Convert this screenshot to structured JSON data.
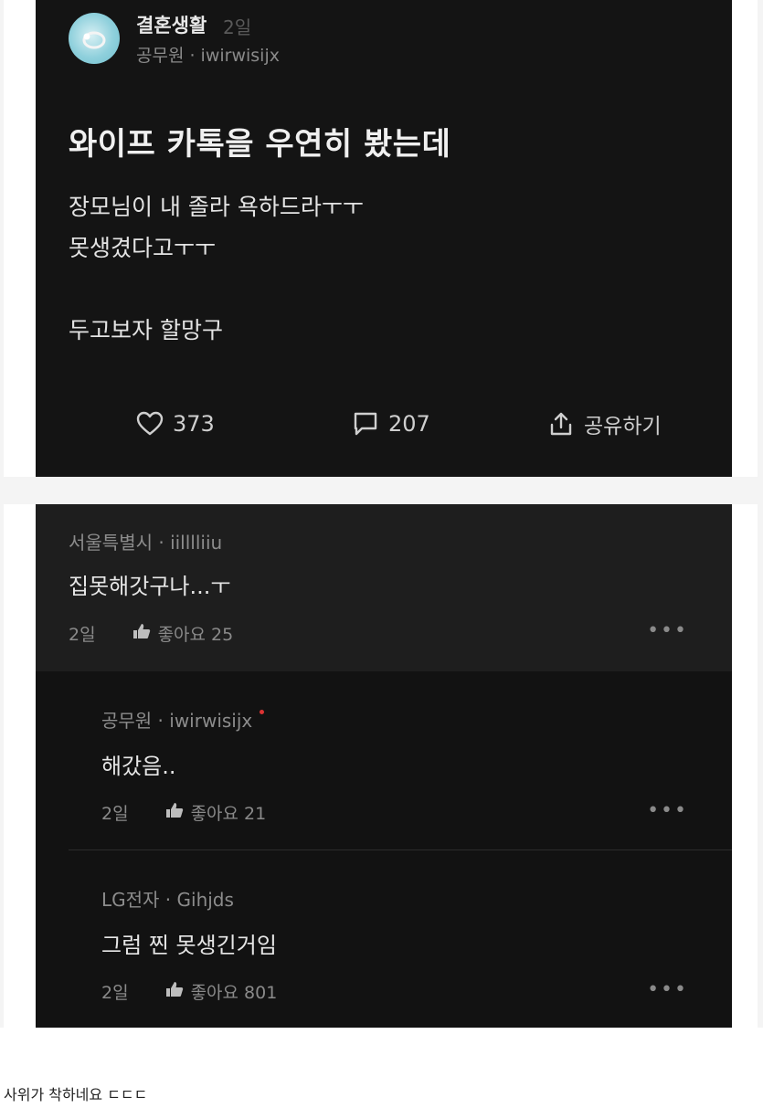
{
  "post": {
    "board_name": "결혼생활",
    "time": "2일",
    "author_line": "공무원 · iwirwisijx",
    "title": "와이프 카톡을 우연히 봤는데",
    "body": "장모님이 내 졸라 욕하드라ㅜㅜ\n못생겼다고ㅜㅜ\n\n두고보자 할망구",
    "like_count": "373",
    "comment_count": "207",
    "share_label": "공유하기"
  },
  "comments": [
    {
      "author": "서울특별시 · iilllliiu",
      "text": "집못해갓구나...ㅜ",
      "time": "2일",
      "likes": "좋아요 25",
      "more": "•••"
    },
    {
      "author": "공무원 · iwirwisijx",
      "text": "해갔음..",
      "time": "2일",
      "likes": "좋아요 21",
      "more": "•••"
    },
    {
      "author": "LG전자 · Gihjds",
      "text": "그럼 찐 못생긴거임",
      "time": "2일",
      "likes": "좋아요 801",
      "more": "•••"
    }
  ],
  "caption": "사위가 착하네요 ㄷㄷㄷ",
  "icons": {
    "avatar": "ring-avatar",
    "like": "heart-icon",
    "comment": "speech-bubble-icon",
    "share": "share-icon",
    "comment_like": "thumbs-up-icon",
    "more": "more-dots-icon"
  },
  "colors": {
    "panel_bg": "#141414",
    "text": "#e6e6e6",
    "muted": "#8a8a8a",
    "author_badge": "#dd3333"
  }
}
